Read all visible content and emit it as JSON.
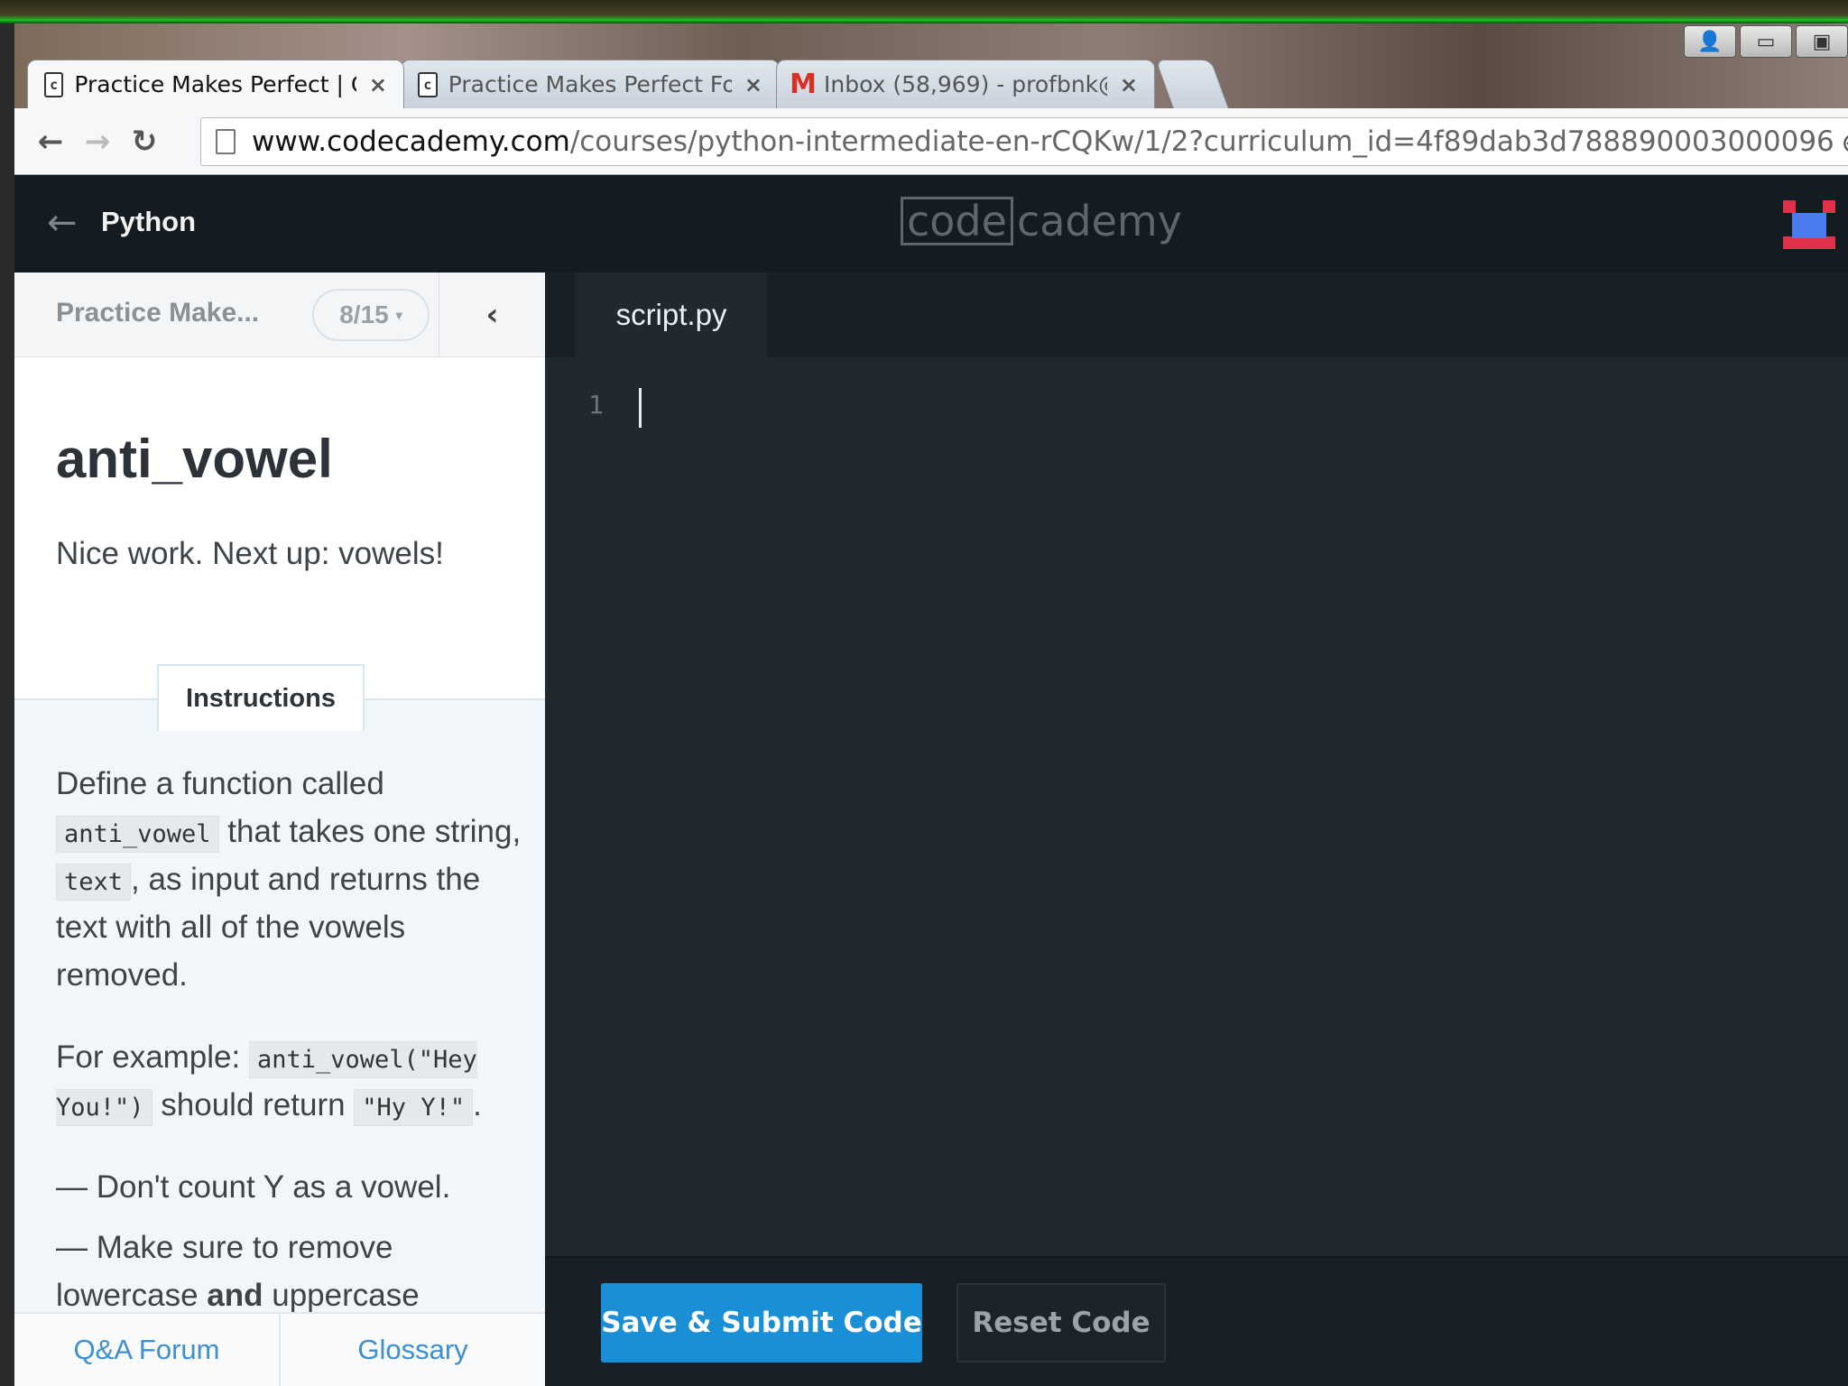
{
  "browser": {
    "tabs": [
      {
        "title": "Practice Makes Perfect | C",
        "icon": "codecademy-icon",
        "active": true
      },
      {
        "title": "Practice Makes Perfect Fo",
        "icon": "codecademy-icon",
        "active": false
      },
      {
        "title": "Inbox (58,969) - profbnk@",
        "icon": "gmail-icon",
        "active": false
      }
    ],
    "tab_icon_glyph": "c",
    "gmail_glyph": "M",
    "close_glyph": "×",
    "back_glyph": "←",
    "forward_glyph": "→",
    "reload_glyph": "↻",
    "zoom_glyph": "⊕",
    "url_host": "www.codecademy.com",
    "url_path": "/courses/python-intermediate-en-rCQKw/1/2?curriculum_id=4f89dab3d788890003000096"
  },
  "header": {
    "back_glyph": "←",
    "course_name": "Python",
    "logo_code": "code",
    "logo_rest": "cademy"
  },
  "lesson": {
    "section_title": "Practice Make...",
    "progress": "8/15",
    "progress_caret": "▾",
    "collapse_glyph": "‹",
    "exercise_title": "anti_vowel",
    "intro": "Nice work. Next up: vowels!",
    "instructions_tab": "Instructions",
    "p1_a": "Define a function called ",
    "p1_code1": "anti_vowel",
    "p1_b": " that takes one string, ",
    "p1_code2": "text",
    "p1_c": ", as input and returns the text with all of the vowels removed.",
    "p2_a": "For example: ",
    "p2_code1": "anti_vowel(\"Hey You!\")",
    "p2_b": " should return ",
    "p2_code2": "\"Hy Y!\"",
    "p2_c": ".",
    "bullet1": "— Don't count Y as a vowel.",
    "bullet2_a": "— Make sure to remove lowercase ",
    "bullet2_b": "and",
    "bullet2_c": " uppercase",
    "footer_links": [
      "Q&A Forum",
      "Glossary"
    ]
  },
  "editor": {
    "file_name": "script.py",
    "line_number": "1",
    "submit_label": "Save & Submit Code",
    "reset_label": "Reset Code"
  },
  "window": {
    "user_glyph": "👤",
    "minimize_glyph": "▭",
    "restore_glyph": "▣"
  }
}
